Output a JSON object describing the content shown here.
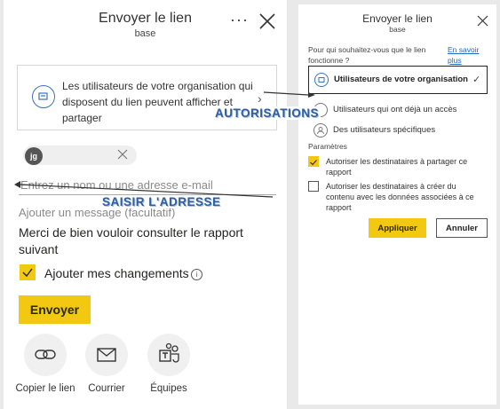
{
  "left_panel": {
    "title": "Envoyer le lien",
    "subtitle": "base",
    "more_label": "···",
    "permission_text": "Les utilisateurs de votre organisation qui disposent du lien peuvent afficher et partager",
    "recipient_chip": "jg",
    "email_placeholder": "Entrez un nom ou une adresse e-mail",
    "message_placeholder": "Ajouter un message (facultatif)",
    "message_text": "Merci de bien vouloir consulter le rapport suivant",
    "include_changes_label": "Ajouter mes changements",
    "info_glyph": "i",
    "send_label": "Envoyer",
    "share_options": [
      {
        "label": "Copier le lien",
        "icon": "link-icon"
      },
      {
        "label": "Courrier",
        "icon": "mail-icon"
      },
      {
        "label": "Équipes",
        "icon": "teams-icon"
      }
    ]
  },
  "right_panel": {
    "title": "Envoyer le lien",
    "subtitle": "base",
    "question": "Pour qui souhaitez-vous que le lien fonctionne ?",
    "learn_more": "En savoir plus",
    "options": [
      {
        "label": "Utilisateurs de votre organisation",
        "selected": true,
        "icon": "building-icon"
      },
      {
        "label": "Utilisateurs qui ont déjà un accès",
        "selected": false,
        "icon": "people-icon"
      },
      {
        "label": "Des utilisateurs spécifiques",
        "selected": false,
        "icon": "person-icon"
      }
    ],
    "settings_heading": "Paramètres",
    "settings": [
      {
        "label": "Autoriser les destinataires à partager ce rapport",
        "checked": true
      },
      {
        "label": "Autoriser les destinataires à créer du contenu avec les données associées à ce rapport",
        "checked": false
      }
    ],
    "apply_label": "Appliquer",
    "cancel_label": "Annuler"
  },
  "annotations": {
    "permissions": "AUTORISATIONS",
    "address": "SAISIR L'ADRESSE"
  },
  "colors": {
    "accent": "#f2c811",
    "callout_text": "#2f5d9e",
    "link": "#1f6ac3"
  }
}
